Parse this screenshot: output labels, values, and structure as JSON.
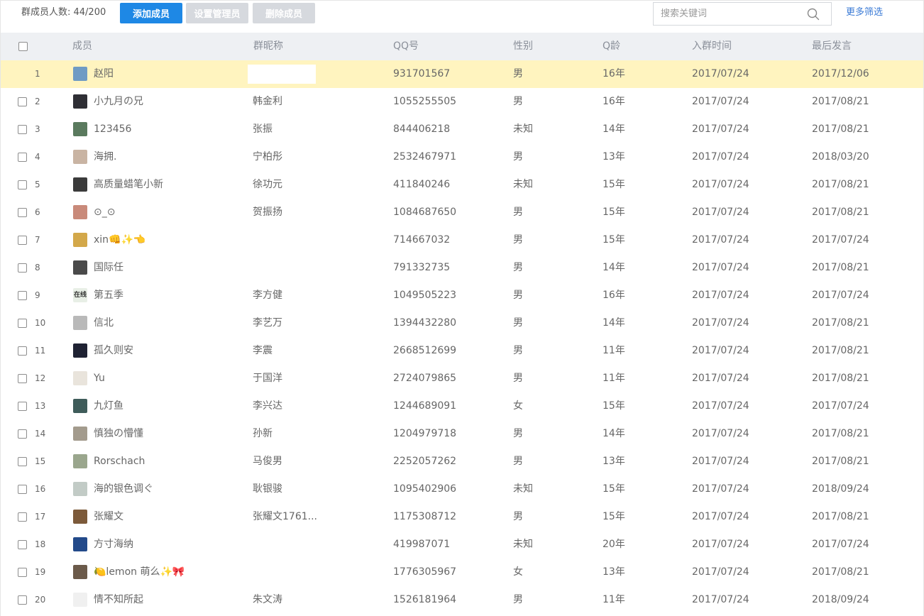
{
  "toolbar": {
    "member_count": "群成员人数: 44/200",
    "add_member": "添加成员",
    "set_admin": "设置管理员",
    "remove_member": "删除成员",
    "search_placeholder": "搜索关键词",
    "more_filter": "更多筛选"
  },
  "columns": [
    "成员",
    "群昵称",
    "QQ号",
    "性别",
    "Q龄",
    "入群时间",
    "最后发言"
  ],
  "rows": [
    {
      "index": "1",
      "name": "赵阳",
      "nickname": "",
      "qq": "931701567",
      "gender": "男",
      "age": "16年",
      "joined": "2017/07/24",
      "last": "2017/12/06",
      "avatar_color": "#6f9bc4",
      "highlight": true
    },
    {
      "index": "2",
      "name": "小九月の兄",
      "nickname": "韩金利",
      "qq": "1055255505",
      "gender": "男",
      "age": "16年",
      "joined": "2017/07/24",
      "last": "2017/08/21",
      "avatar_color": "#2f2f35"
    },
    {
      "index": "3",
      "name": "123456",
      "nickname": "张振",
      "qq": "844406218",
      "gender": "未知",
      "age": "14年",
      "joined": "2017/07/24",
      "last": "2017/08/21",
      "avatar_color": "#5a7a5e"
    },
    {
      "index": "4",
      "name": "海拥.",
      "nickname": "宁柏彤",
      "qq": "2532467971",
      "gender": "男",
      "age": "13年",
      "joined": "2017/07/24",
      "last": "2018/03/20",
      "avatar_color": "#c9b4a3"
    },
    {
      "index": "5",
      "name": "高质量蜡笔小新",
      "nickname": "徐功元",
      "qq": "411840246",
      "gender": "未知",
      "age": "15年",
      "joined": "2017/07/24",
      "last": "2017/08/21",
      "avatar_color": "#3b3b3b"
    },
    {
      "index": "6",
      "name": "⊙_⊙",
      "nickname": "贺振扬",
      "qq": "1084687650",
      "gender": "男",
      "age": "15年",
      "joined": "2017/07/24",
      "last": "2017/08/21",
      "avatar_color": "#c98a7a"
    },
    {
      "index": "7",
      "name": "xin👊✨👈",
      "nickname": "",
      "qq": "714667032",
      "gender": "男",
      "age": "15年",
      "joined": "2017/07/24",
      "last": "2017/07/24",
      "avatar_color": "#d3a84a"
    },
    {
      "index": "8",
      "name": "国际任",
      "nickname": "",
      "qq": "791332735",
      "gender": "男",
      "age": "14年",
      "joined": "2017/07/24",
      "last": "2017/08/21",
      "avatar_color": "#4a4a4a"
    },
    {
      "index": "9",
      "name": "第五季",
      "nickname": "李方健",
      "qq": "1049505223",
      "gender": "男",
      "age": "16年",
      "joined": "2017/07/24",
      "last": "2017/07/24",
      "avatar_color": "#e8efe6",
      "avatar_text": "在线"
    },
    {
      "index": "10",
      "name": "信北",
      "nickname": "李艺万",
      "qq": "1394432280",
      "gender": "男",
      "age": "14年",
      "joined": "2017/07/24",
      "last": "2017/08/21",
      "avatar_color": "#b9b9b9"
    },
    {
      "index": "11",
      "name": "孤久则安",
      "nickname": "李震",
      "qq": "2668512699",
      "gender": "男",
      "age": "11年",
      "joined": "2017/07/24",
      "last": "2017/08/21",
      "avatar_color": "#1f2233"
    },
    {
      "index": "12",
      "name": "Yu",
      "nickname": "于国洋",
      "qq": "2724079865",
      "gender": "男",
      "age": "11年",
      "joined": "2017/07/24",
      "last": "2017/08/21",
      "avatar_color": "#e9e4dc"
    },
    {
      "index": "13",
      "name": "九灯鱼",
      "nickname": "李兴达",
      "qq": "1244689091",
      "gender": "女",
      "age": "15年",
      "joined": "2017/07/24",
      "last": "2017/07/24",
      "avatar_color": "#3f5c5a"
    },
    {
      "index": "14",
      "name": "慎独の懵懂",
      "nickname": "孙新",
      "qq": "1204979718",
      "gender": "男",
      "age": "14年",
      "joined": "2017/07/24",
      "last": "2017/08/21",
      "avatar_color": "#a39b8d"
    },
    {
      "index": "15",
      "name": "Rorschach",
      "nickname": "马俊男",
      "qq": "2252057262",
      "gender": "男",
      "age": "13年",
      "joined": "2017/07/24",
      "last": "2017/08/21",
      "avatar_color": "#9aa68d"
    },
    {
      "index": "16",
      "name": "海的银色调ぐ",
      "nickname": "耿银骏",
      "qq": "1095402906",
      "gender": "未知",
      "age": "15年",
      "joined": "2017/07/24",
      "last": "2018/09/24",
      "avatar_color": "#c2cbc6"
    },
    {
      "index": "17",
      "name": "张耀文",
      "nickname": "张耀文1761...",
      "qq": "1175308712",
      "gender": "男",
      "age": "15年",
      "joined": "2017/07/24",
      "last": "2017/08/21",
      "avatar_color": "#7c5a3a"
    },
    {
      "index": "18",
      "name": "方寸海纳",
      "nickname": "",
      "qq": "419987071",
      "gender": "未知",
      "age": "20年",
      "joined": "2017/07/24",
      "last": "2017/07/24",
      "avatar_color": "#234a8a"
    },
    {
      "index": "19",
      "name": "🍋lemon 萌么✨🎀",
      "nickname": "",
      "qq": "1776305967",
      "gender": "女",
      "age": "13年",
      "joined": "2017/07/24",
      "last": "2017/08/21",
      "avatar_color": "#6b5a4a"
    },
    {
      "index": "20",
      "name": "情不知所起",
      "nickname": "朱文涛",
      "qq": "1526181964",
      "gender": "男",
      "age": "11年",
      "joined": "2017/07/24",
      "last": "2018/09/24",
      "avatar_color": "#f0f0f0"
    }
  ]
}
